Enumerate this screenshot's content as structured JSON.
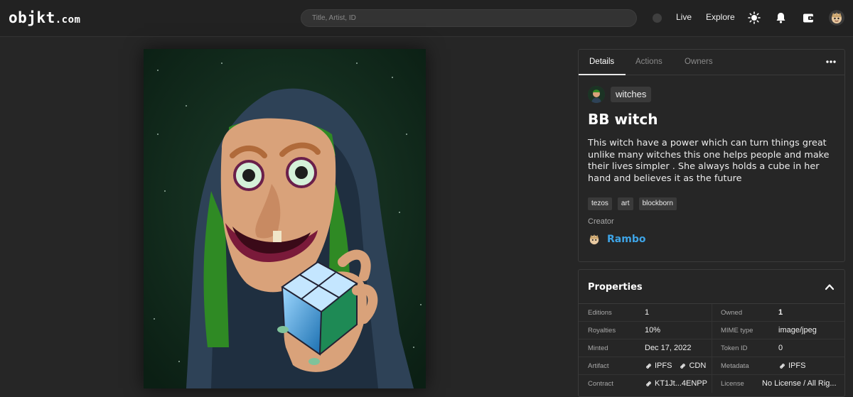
{
  "header": {
    "logo_main": "objkt",
    "logo_suffix": ".com",
    "search_placeholder": "Title, Artist, ID",
    "nav": {
      "live": "Live",
      "explore": "Explore"
    },
    "icons": [
      "sun-icon",
      "bell-icon",
      "wallet-icon",
      "avatar-icon"
    ]
  },
  "details": {
    "tabs": [
      "Details",
      "Actions",
      "Owners"
    ],
    "collection": "witches",
    "title": "BB witch",
    "description": "This witch have a power which can turn things great unlike many witches this one helps people and make their lives simpler . She always holds a cube in her hand and believes it as the future",
    "tags": [
      "tezos",
      "art",
      "blockborn"
    ],
    "creator_label": "Creator",
    "creator_name": "Rambo"
  },
  "properties": {
    "title": "Properties",
    "rows": [
      {
        "label_left": "Editions",
        "value_left": "1",
        "label_right": "Owned",
        "value_right": "1"
      },
      {
        "label_left": "Royalties",
        "value_left": "10%",
        "label_right": "MIME type",
        "value_right": "image/jpeg"
      },
      {
        "label_left": "Minted",
        "value_left": "Dec 17, 2022",
        "label_right": "Token ID",
        "value_right": "0"
      },
      {
        "label_left": "Artifact",
        "links_left": [
          "IPFS",
          "CDN"
        ],
        "label_right": "Metadata",
        "links_right": [
          "IPFS"
        ]
      },
      {
        "label_left": "Contract",
        "links_left": [
          "KT1Jt...4ENPP"
        ],
        "label_right": "License",
        "value_right": "No License / All Rig..."
      }
    ]
  },
  "colors": {
    "accent_link": "#3ea4e6",
    "background": "#262626",
    "border": "#3a3a3a"
  }
}
